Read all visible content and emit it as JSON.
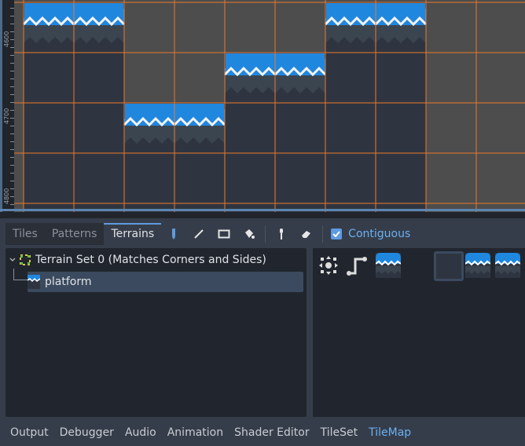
{
  "viewport": {
    "ruler_labels": [
      "4600",
      "4700",
      "4800"
    ],
    "columns_filled_from_row": [
      0,
      0,
      2,
      2,
      1,
      1,
      0,
      0,
      null,
      null
    ],
    "colors": {
      "grid": "#e8792b",
      "background": "#4d4d4d",
      "tile_fill": "#2f3540",
      "tile_band": "#3b4550",
      "cap": "#2087df",
      "wave": "#f4f4f4"
    }
  },
  "panel": {
    "tabs": [
      {
        "label": "Tiles"
      },
      {
        "label": "Patterns"
      },
      {
        "label": "Terrains",
        "active": true
      }
    ],
    "tools": [
      "pencil-icon",
      "line-icon",
      "rect-icon",
      "bucket-icon",
      "picker-icon",
      "eraser-icon"
    ],
    "contiguous": {
      "label": "Contiguous",
      "checked": true
    },
    "tree": {
      "terrain_set": "Terrain Set 0 (Matches Corners and Sides)",
      "terrain": "platform"
    },
    "palette": [
      "connect-mode-icon",
      "path-mode-icon",
      "tile",
      "tile-selected",
      "tile",
      "tile",
      "tile"
    ]
  },
  "bottom_tabs": [
    {
      "label": "Output"
    },
    {
      "label": "Debugger"
    },
    {
      "label": "Audio"
    },
    {
      "label": "Animation"
    },
    {
      "label": "Shader Editor"
    },
    {
      "label": "TileSet"
    },
    {
      "label": "TileMap",
      "active": true
    }
  ]
}
